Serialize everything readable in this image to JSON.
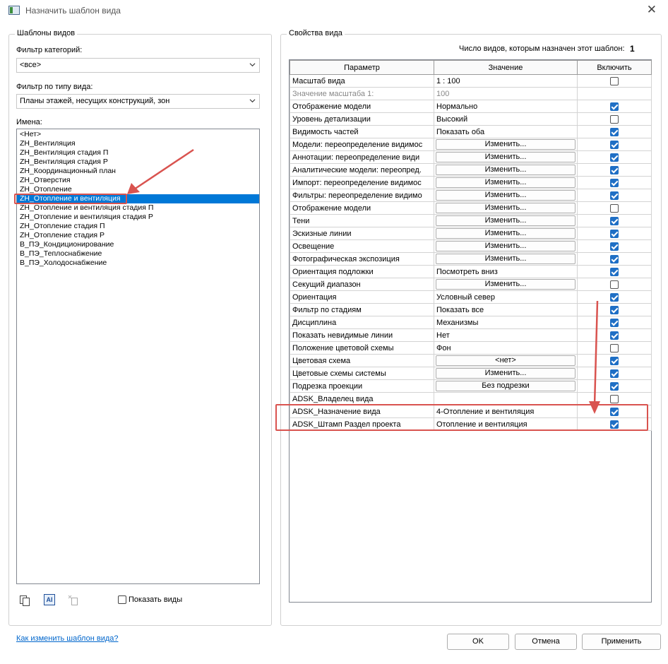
{
  "window": {
    "title": "Назначить шаблон вида",
    "close_glyph": "✕"
  },
  "left": {
    "group_title": "Шаблоны видов",
    "category_filter_label": "Фильтр категорий:",
    "category_filter_value": "<все>",
    "type_filter_label": "Фильтр по типу вида:",
    "type_filter_value": "Планы этажей, несущих конструкций, зон",
    "names_label": "Имена:",
    "names": [
      "<Нет>",
      "ZH_Вентиляция",
      "ZH_Вентиляция стадия П",
      "ZH_Вентиляция стадия Р",
      "ZH_Координационный план",
      "ZH_Отверстия",
      "ZH_Отопление",
      "ZH_Отопление и вентиляция",
      "ZH_Отопление и вентиляция стадия П",
      "ZH_Отопление и вентиляция стадия Р",
      "ZH_Отопление стадия П",
      "ZH_Отопление стадия Р",
      "В_ПЭ_Кондиционирование",
      "В_ПЭ_Теплоснабжение",
      "В_ПЭ_Холодоснабжение"
    ],
    "selected_index": 7,
    "show_views_label": "Показать виды",
    "show_views_checked": false,
    "icon_duplicate_text": "",
    "icon_rename_text": "AI"
  },
  "right": {
    "group_title": "Свойства вида",
    "count_label": "Число видов, которым назначен этот шаблон:",
    "count_value": "1",
    "columns": [
      "Параметр",
      "Значение",
      "Включить"
    ],
    "rows": [
      {
        "param": "Масштаб вида",
        "value": "1 : 100",
        "kind": "text",
        "include": false,
        "grey": false
      },
      {
        "param": "Значение масштаба    1:",
        "value": "100",
        "kind": "text",
        "include": null,
        "grey": true
      },
      {
        "param": "Отображение модели",
        "value": "Нормально",
        "kind": "text",
        "include": true,
        "grey": false
      },
      {
        "param": "Уровень детализации",
        "value": "Высокий",
        "kind": "text",
        "include": false,
        "grey": false
      },
      {
        "param": "Видимость частей",
        "value": "Показать оба",
        "kind": "text",
        "include": true,
        "grey": false
      },
      {
        "param": "Модели: переопределение видимос",
        "value": "Изменить...",
        "kind": "button",
        "include": true,
        "grey": false
      },
      {
        "param": "Аннотации: переопределение види",
        "value": "Изменить...",
        "kind": "button",
        "include": true,
        "grey": false
      },
      {
        "param": "Аналитические модели: переопред.",
        "value": "Изменить...",
        "kind": "button",
        "include": true,
        "grey": false
      },
      {
        "param": "Импорт: переопределение видимос",
        "value": "Изменить...",
        "kind": "button",
        "include": true,
        "grey": false
      },
      {
        "param": "Фильтры: переопределение видимо",
        "value": "Изменить...",
        "kind": "button",
        "include": true,
        "grey": false
      },
      {
        "param": "Отображение модели",
        "value": "Изменить...",
        "kind": "button",
        "include": false,
        "grey": false
      },
      {
        "param": "Тени",
        "value": "Изменить...",
        "kind": "button",
        "include": true,
        "grey": false
      },
      {
        "param": "Эскизные линии",
        "value": "Изменить...",
        "kind": "button",
        "include": true,
        "grey": false
      },
      {
        "param": "Освещение",
        "value": "Изменить...",
        "kind": "button",
        "include": true,
        "grey": false
      },
      {
        "param": "Фотографическая экспозиция",
        "value": "Изменить...",
        "kind": "button",
        "include": true,
        "grey": false
      },
      {
        "param": "Ориентация подложки",
        "value": "Посмотреть вниз",
        "kind": "text",
        "include": true,
        "grey": false
      },
      {
        "param": "Секущий диапазон",
        "value": "Изменить...",
        "kind": "button",
        "include": false,
        "grey": false
      },
      {
        "param": "Ориентация",
        "value": "Условный север",
        "kind": "text",
        "include": true,
        "grey": false
      },
      {
        "param": "Фильтр по стадиям",
        "value": "Показать все",
        "kind": "text",
        "include": true,
        "grey": false
      },
      {
        "param": "Дисциплина",
        "value": "Механизмы",
        "kind": "text",
        "include": true,
        "grey": false
      },
      {
        "param": "Показать невидимые линии",
        "value": "Нет",
        "kind": "text",
        "include": true,
        "grey": false
      },
      {
        "param": "Положение цветовой схемы",
        "value": "Фон",
        "kind": "text",
        "include": false,
        "grey": false
      },
      {
        "param": "Цветовая схема",
        "value": "<нет>",
        "kind": "button",
        "include": true,
        "grey": false
      },
      {
        "param": "Цветовые схемы системы",
        "value": "Изменить...",
        "kind": "button",
        "include": true,
        "grey": false
      },
      {
        "param": "Подрезка проекции",
        "value": "Без подрезки",
        "kind": "button",
        "include": true,
        "grey": false
      },
      {
        "param": "ADSK_Владелец вида",
        "value": "",
        "kind": "text",
        "include": false,
        "grey": false
      },
      {
        "param": "ADSK_Назначение вида",
        "value": "4-Отопление и вентиляция",
        "kind": "text",
        "include": true,
        "grey": false
      },
      {
        "param": "ADSK_Штамп Раздел проекта",
        "value": "Отопление и вентиляция",
        "kind": "text",
        "include": true,
        "grey": false
      }
    ]
  },
  "footer": {
    "help_link": "Как изменить шаблон вида?",
    "ok": "OK",
    "cancel": "Отмена",
    "apply": "Применить"
  },
  "colors": {
    "selection": "#0078d7",
    "checkbox_on": "#1f6fc5",
    "annotation_red": "#d9534f",
    "link": "#0066cc"
  }
}
